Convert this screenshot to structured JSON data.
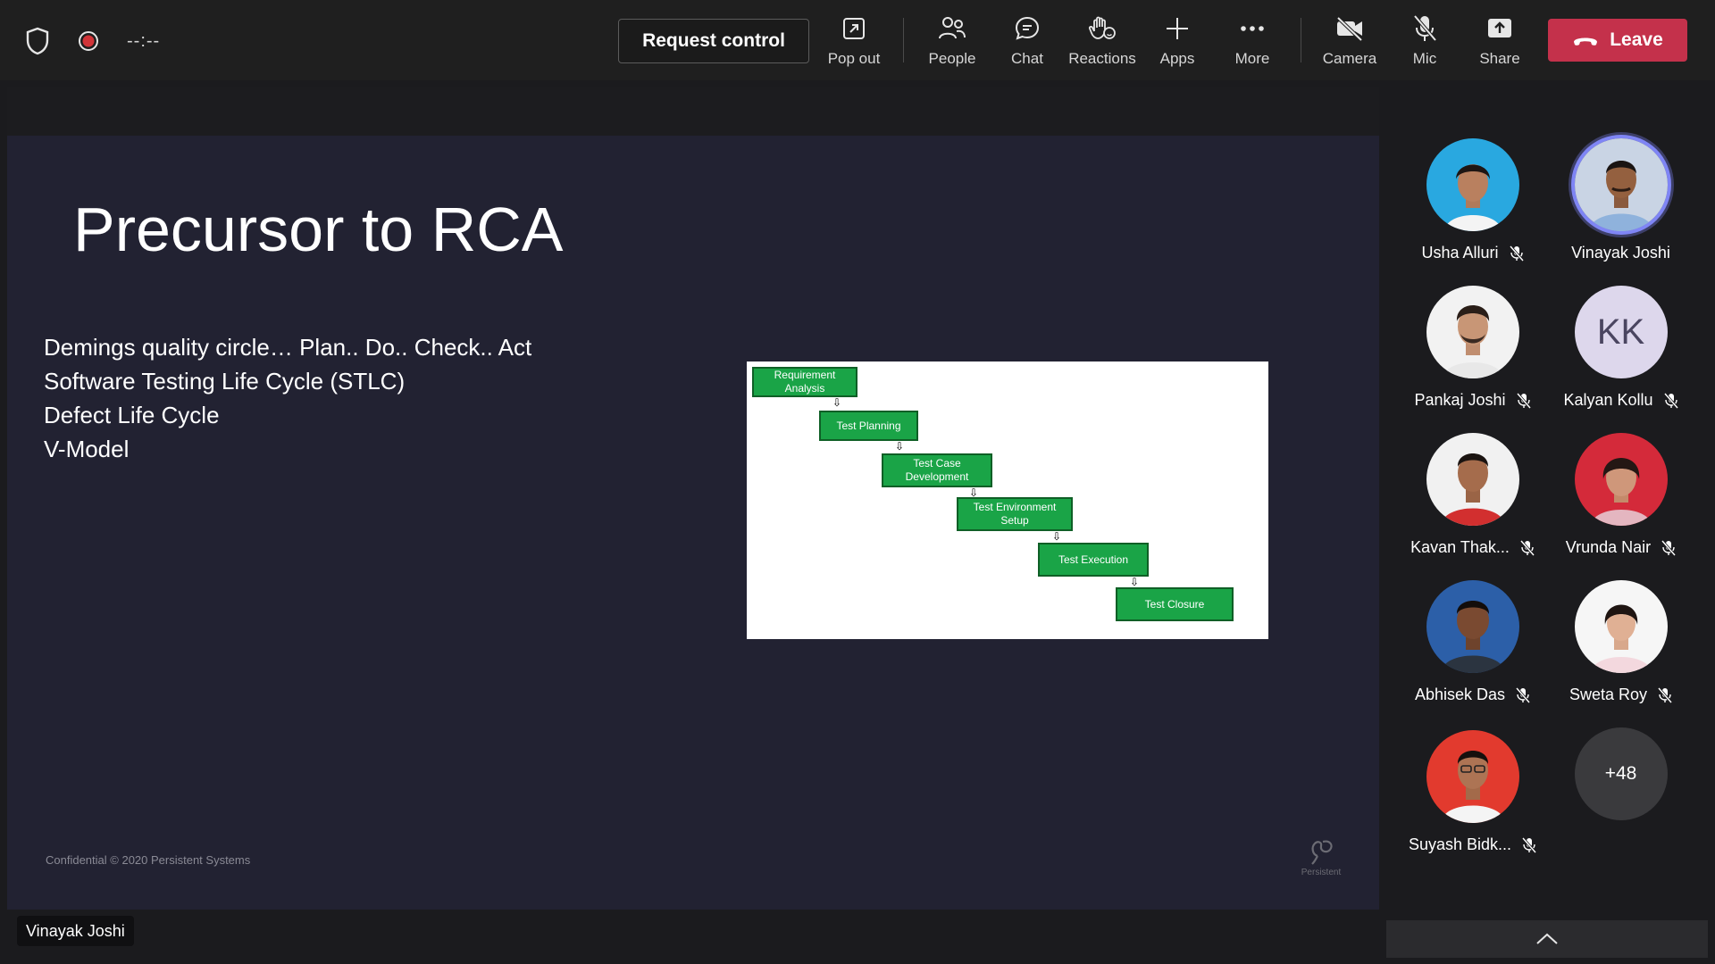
{
  "meeting": {
    "timer": "--:--",
    "request_control_label": "Request control",
    "leave_label": "Leave",
    "toolbar": [
      {
        "label": "Pop out",
        "icon": "pop-out-icon"
      },
      {
        "label": "People",
        "icon": "people-icon"
      },
      {
        "label": "Chat",
        "icon": "chat-icon"
      },
      {
        "label": "Reactions",
        "icon": "reactions-icon"
      },
      {
        "label": "Apps",
        "icon": "apps-plus-icon"
      },
      {
        "label": "More",
        "icon": "more-dots-icon"
      },
      {
        "label": "Camera",
        "icon": "camera-off-icon"
      },
      {
        "label": "Mic",
        "icon": "mic-off-icon"
      },
      {
        "label": "Share",
        "icon": "share-icon"
      }
    ],
    "leave_color": "#c4314b"
  },
  "slide": {
    "title": "Precursor to RCA",
    "bullets": [
      "Demings quality circle… Plan.. Do.. Check.. Act",
      "Software Testing Life Cycle (STLC)",
      "Defect Life Cycle",
      "V-Model"
    ],
    "diagram_steps": [
      "Requirement Analysis",
      "Test Planning",
      "Test Case Development",
      "Test Environment Setup",
      "Test Execution",
      "Test Closure"
    ],
    "footer": "Confidential © 2020 Persistent Systems",
    "logo_text": "Persistent",
    "step_color": "#1aa447"
  },
  "presenter_name": "Vinayak Joshi",
  "participants": [
    {
      "name": "Usha Alluri",
      "muted": true,
      "avatar": "photo"
    },
    {
      "name": "Vinayak Joshi",
      "muted": false,
      "avatar": "photo",
      "speaking": true
    },
    {
      "name": "Pankaj Joshi",
      "muted": true,
      "avatar": "photo"
    },
    {
      "name": "Kalyan Kollu",
      "muted": true,
      "avatar": "initials",
      "initials": "KK"
    },
    {
      "name": "Kavan Thak...",
      "muted": true,
      "avatar": "photo"
    },
    {
      "name": "Vrunda Nair",
      "muted": true,
      "avatar": "photo"
    },
    {
      "name": "Abhisek Das",
      "muted": true,
      "avatar": "photo"
    },
    {
      "name": "Sweta Roy",
      "muted": true,
      "avatar": "photo"
    },
    {
      "name": "Suyash Bidk...",
      "muted": true,
      "avatar": "photo"
    }
  ],
  "overflow_count": "+48"
}
